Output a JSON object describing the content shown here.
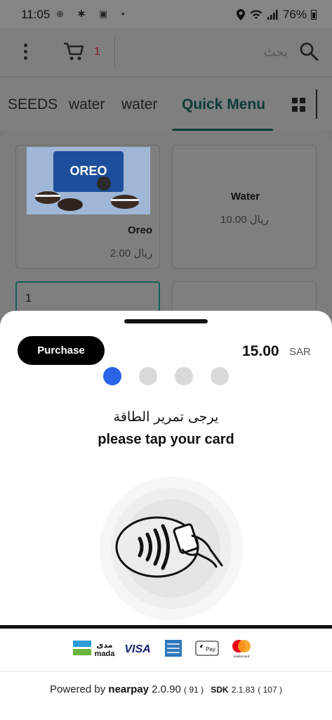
{
  "status_bar": {
    "time": "11:05",
    "left_icons": "⊕ ✱ ▣ •",
    "battery": "76%"
  },
  "header": {
    "cart_count": "1",
    "search_placeholder": "بحث"
  },
  "tabs": [
    {
      "label": "SEEDS"
    },
    {
      "label": "water"
    },
    {
      "label": "water"
    },
    {
      "label": "Quick Menu",
      "active": true
    }
  ],
  "products": [
    {
      "name": "Oreo",
      "price": "2.00 ريال"
    },
    {
      "name": "Water",
      "price": "10.00 ريال"
    }
  ],
  "quantity_value": "1",
  "image_text": {
    "oreo_brand": "OREO"
  },
  "payment": {
    "purchase_label": "Purchase",
    "amount": "15.00",
    "currency": "SAR",
    "step_count": 4,
    "active_step": 1,
    "instruction_ar": "يرجى تمرير الطاقة",
    "instruction_en": "please tap your card"
  },
  "card_brands": {
    "mada_ar": "مدى",
    "mada_en": "mada",
    "visa": "VISA",
    "applepay": "Pay",
    "mastercard": "mastercard"
  },
  "footer": {
    "powered_by": "Powered by",
    "brand": "nearpay",
    "version": "2.0.90",
    "build": "( 91 )",
    "sdk_label": "SDK",
    "sdk_version": "2.1.83",
    "sdk_build": "( 107 )"
  },
  "colors": {
    "accent_dark_green": "#0b3d36",
    "active_dot": "#2b63e8",
    "overlay_gray": "#7f7f7f"
  }
}
